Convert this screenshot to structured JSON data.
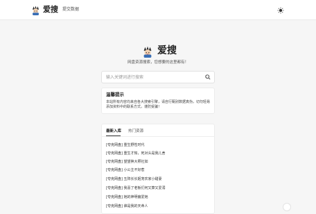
{
  "header": {
    "brand": "爱搜",
    "nav_link": "提交数据"
  },
  "hero": {
    "title": "爱搜",
    "subtitle": "网盘资源搜索，您想要的这里都有！"
  },
  "search": {
    "placeholder": "输入关键词进行搜索",
    "value": ""
  },
  "notice": {
    "title": "温馨提示",
    "body": "本站所有内容均来自各大搜索引擎，请自行甄别数据真伪，切勿轻易添加资料中的联系方式，谨防受骗！"
  },
  "list": {
    "tabs": [
      "最新入库",
      "热门资源"
    ],
    "active_tab": "最新入库",
    "items": [
      "[夸克网盘] 重生野性时代",
      "[夸克网盘] 重生才知，死对头是我儿舍",
      "[夸克网盘] 望望换大照社如",
      "[夸克网盘] 小公主不好惹",
      "[夸克网盘] 五阵长长姬宠农家小甜妻",
      "[夸克网盘] 我喜了老板们何又算又爱溺",
      "[夸克网盘] 她的神明偏爱她",
      "[夸克网盘] 谁是我的天命人"
    ]
  },
  "colors": {
    "background": "#f6f6f6",
    "card": "#ffffff",
    "text": "#333333"
  }
}
